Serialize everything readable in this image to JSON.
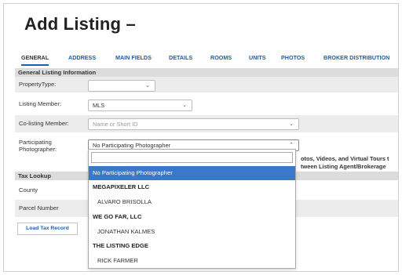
{
  "page": {
    "title": "Add Listing –"
  },
  "tabs": [
    {
      "label": "GENERAL",
      "active": true
    },
    {
      "label": "ADDRESS"
    },
    {
      "label": "MAIN FIELDS"
    },
    {
      "label": "DETAILS"
    },
    {
      "label": "ROOMS"
    },
    {
      "label": "UNITS"
    },
    {
      "label": "PHOTOS"
    },
    {
      "label": "BROKER DISTRIBUTION"
    }
  ],
  "general": {
    "header": "General Listing Information",
    "property_type": {
      "label": "PropertyType:",
      "value": ""
    },
    "listing_member": {
      "label": "Listing Member:",
      "value": "MLS"
    },
    "co_listing_member": {
      "label": "Co-listing Member:",
      "placeholder": "Name or Short ID"
    },
    "photographer": {
      "label_line1": "Participating",
      "label_line2": "Photographer:",
      "value": "No Participating Photographer"
    },
    "clipped_text_1": "otos, Videos, and Virtual Tours t",
    "clipped_text_2": "tween Listing Agent/Brokerage"
  },
  "tax": {
    "header": "Tax Lookup",
    "county_label": "County",
    "parcel_label": "Parcel Number",
    "load_button": "Load Tax Record"
  },
  "dropdown": {
    "search_value": "",
    "items": [
      {
        "text": "No Participating Photographer",
        "kind": "selected"
      },
      {
        "text": "MEGAPIXELER LLC",
        "kind": "group"
      },
      {
        "text": "ALVARO BRISOLLA",
        "kind": "child"
      },
      {
        "text": "WE GO FAR, LLC",
        "kind": "group"
      },
      {
        "text": "JONATHAN KALMES",
        "kind": "child"
      },
      {
        "text": "THE LISTING EDGE",
        "kind": "group"
      },
      {
        "text": "RICK FARMER",
        "kind": "child"
      }
    ]
  },
  "colors": {
    "link_blue": "#1f5da6",
    "selected_bg": "#3b78cc",
    "section_bg": "#dcdcdc"
  }
}
